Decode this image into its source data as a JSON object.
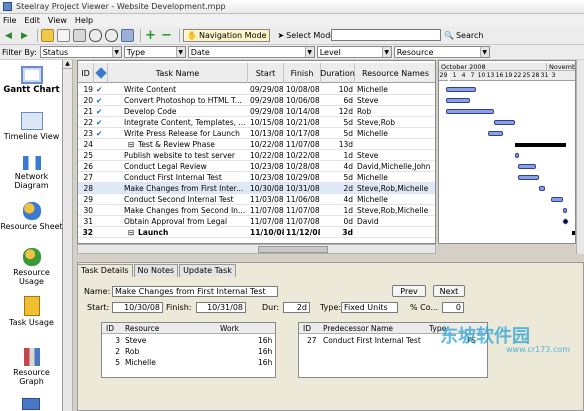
{
  "window": {
    "title": "Steelray Project Viewer - Website Development.mpp"
  },
  "menu": [
    "File",
    "Edit",
    "View",
    "Help"
  ],
  "toolbar": {
    "navigation_mode": "Navigation Mode",
    "select_mode": "Select Mode",
    "search_label": "Search",
    "search_value": ""
  },
  "filters": {
    "label": "Filter By:",
    "status": "Status",
    "type": "Type",
    "date": "Date",
    "level": "Level",
    "resource": "Resource"
  },
  "views": [
    {
      "label": "Gantt Chart",
      "icon": "gantt-chart-icon"
    },
    {
      "label": "Timeline View",
      "icon": "timeline-icon"
    },
    {
      "label": "Network Diagram",
      "icon": "network-diagram-icon"
    },
    {
      "label": "Resource Sheet",
      "icon": "resource-sheet-icon"
    },
    {
      "label": "Resource Usage",
      "icon": "resource-usage-icon"
    },
    {
      "label": "Task Usage",
      "icon": "task-usage-icon"
    },
    {
      "label": "Resource Graph",
      "icon": "resource-graph-icon"
    }
  ],
  "grid": {
    "columns": [
      "ID",
      "Task Name",
      "Start",
      "Finish",
      "Duration",
      "Resource Names"
    ],
    "rows": [
      {
        "id": "19",
        "check": true,
        "name": "Write Content",
        "start": "09/29/08",
        "finish": "10/08/08",
        "duration": "10d",
        "resources": "Michelle"
      },
      {
        "id": "20",
        "check": true,
        "name": "Convert Photoshop to HTML T...",
        "start": "09/29/08",
        "finish": "10/06/08",
        "duration": "6d",
        "resources": "Steve"
      },
      {
        "id": "21",
        "check": true,
        "name": "Develop Code",
        "start": "09/29/08",
        "finish": "10/14/08",
        "duration": "12d",
        "resources": "Rob"
      },
      {
        "id": "22",
        "check": true,
        "name": "Integrate Content, Templates, ...",
        "start": "10/15/08",
        "finish": "10/21/08",
        "duration": "5d",
        "resources": "Steve,Rob"
      },
      {
        "id": "23",
        "check": true,
        "name": "Write Press Release for Launch",
        "start": "10/13/08",
        "finish": "10/17/08",
        "duration": "5d",
        "resources": "Michelle"
      },
      {
        "id": "24",
        "check": false,
        "summary": true,
        "name": "Test & Review Phase",
        "start": "10/22/08",
        "finish": "11/07/08",
        "duration": "13d",
        "resources": ""
      },
      {
        "id": "25",
        "check": false,
        "name": "Publish website to test server",
        "start": "10/22/08",
        "finish": "10/22/08",
        "duration": "1d",
        "resources": "Steve"
      },
      {
        "id": "26",
        "check": false,
        "name": "Conduct Legal Review",
        "start": "10/23/08",
        "finish": "10/28/08",
        "duration": "4d",
        "resources": "David,Michelle,John"
      },
      {
        "id": "27",
        "check": false,
        "name": "Conduct First Internal Test",
        "start": "10/23/08",
        "finish": "10/29/08",
        "duration": "5d",
        "resources": "Michelle"
      },
      {
        "id": "28",
        "check": false,
        "name": "Make Changes from First Inter...",
        "start": "10/30/08",
        "finish": "10/31/08",
        "duration": "2d",
        "resources": "Steve,Rob,Michelle"
      },
      {
        "id": "29",
        "check": false,
        "name": "Conduct Second Internal Test",
        "start": "11/03/08",
        "finish": "11/06/08",
        "duration": "4d",
        "resources": "Michelle"
      },
      {
        "id": "30",
        "check": false,
        "name": "Make Changes from Second In...",
        "start": "11/07/08",
        "finish": "11/07/08",
        "duration": "1d",
        "resources": "Steve,Rob,Michelle"
      },
      {
        "id": "31",
        "check": false,
        "name": "Obtain Approval from Legal",
        "start": "11/07/08",
        "finish": "11/07/08",
        "duration": "0d",
        "resources": "David"
      },
      {
        "id": "32",
        "check": false,
        "summary": true,
        "bold": true,
        "name": "Launch",
        "start": "11/10/08",
        "finish": "11/12/08",
        "duration": "3d",
        "resources": ""
      }
    ]
  },
  "gantt": {
    "months": [
      "October 2008",
      "November"
    ],
    "days": [
      "29",
      "1",
      "4",
      "7",
      "10",
      "13",
      "16",
      "19",
      "22",
      "25",
      "28",
      "31",
      "3"
    ]
  },
  "detail": {
    "tabs": [
      "Task Details",
      "No Notes",
      "Update Task"
    ],
    "name_label": "Name:",
    "name_value": "Make Changes from First Internal Test",
    "prev": "Prev",
    "next": "Next",
    "start_label": "Start:",
    "start_value": "10/30/08",
    "finish_label": "Finish:",
    "finish_value": "10/31/08",
    "dur_label": "Dur:",
    "dur_value": "2d",
    "type_label": "Type:",
    "type_value": "Fixed Units",
    "complete_label": "% Co...",
    "complete_value": "0",
    "resources_columns": [
      "ID",
      "Resource",
      "Work"
    ],
    "resources": [
      {
        "id": "3",
        "name": "Steve",
        "work": "16h"
      },
      {
        "id": "2",
        "name": "Rob",
        "work": "16h"
      },
      {
        "id": "5",
        "name": "Michelle",
        "work": "16h"
      }
    ],
    "predecessor_columns": [
      "ID",
      "Predecessor Name",
      "Type"
    ],
    "predecessors": [
      {
        "id": "27",
        "name": "Conduct First Internal Test",
        "type": "FS"
      }
    ]
  },
  "watermark": {
    "text": "东坡软件园",
    "sub": "www.cr173.com"
  }
}
